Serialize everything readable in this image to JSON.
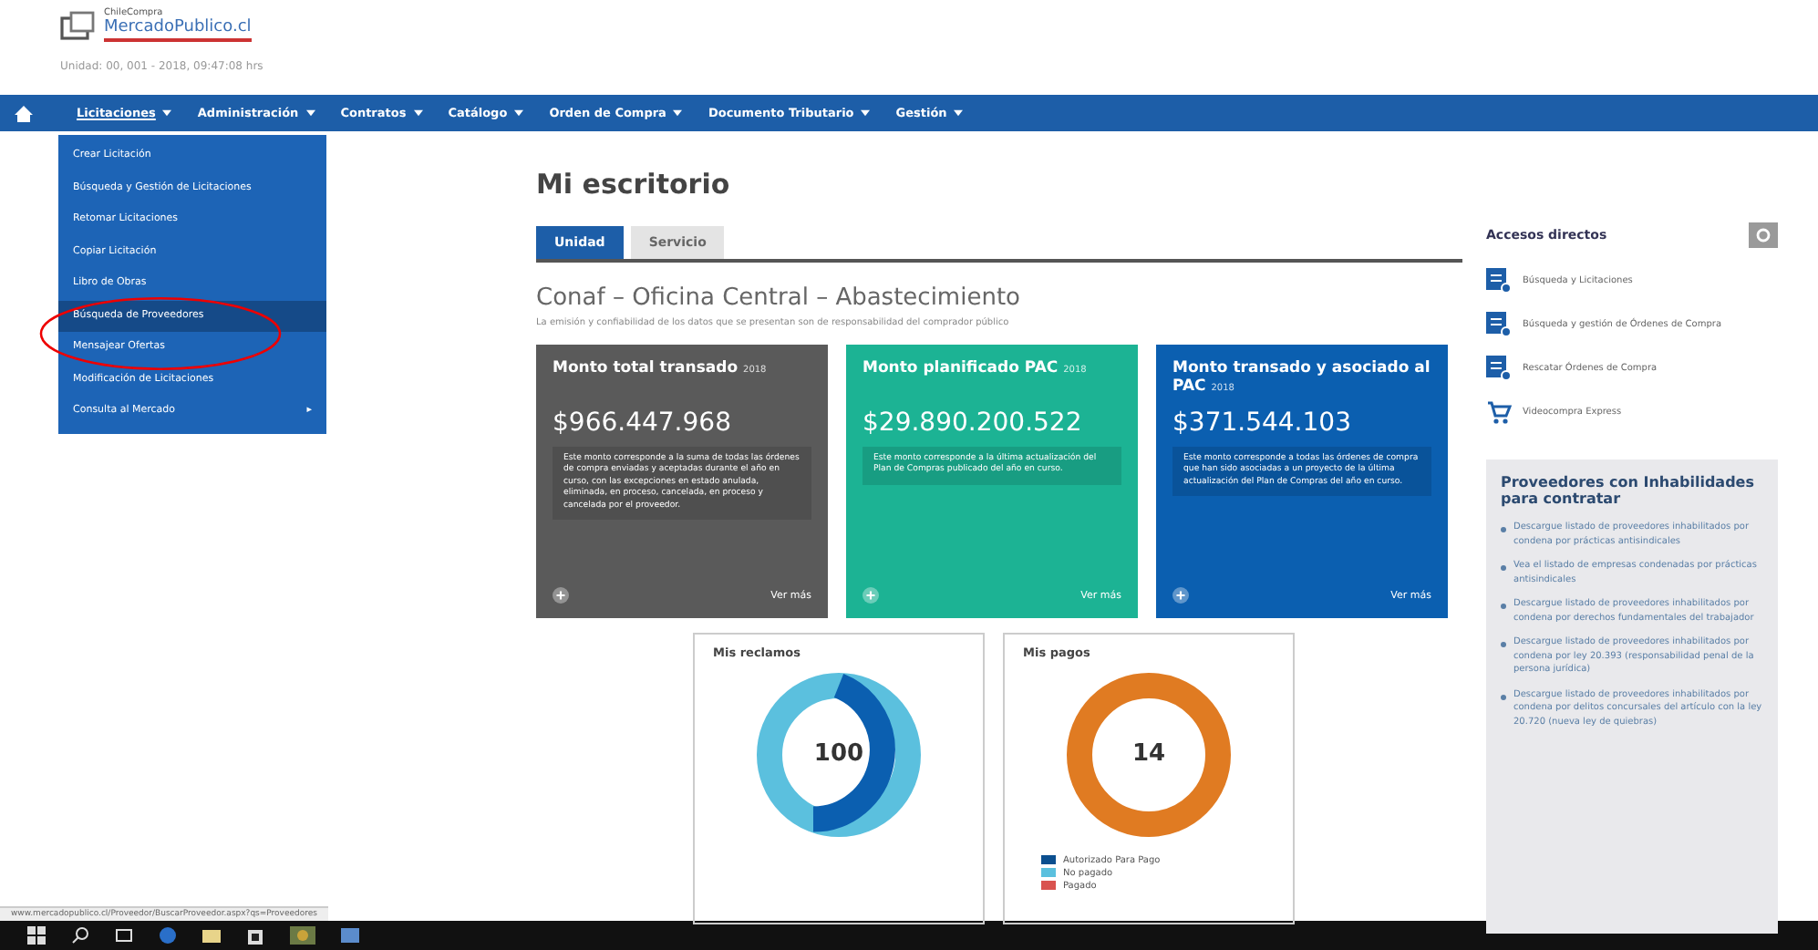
{
  "header": {
    "logo_caption": "ChileCompra",
    "logo_text": "MercadoPublico.cl",
    "tagline": "Unidad: 00, 001 - 2018, 09:47:08 hrs"
  },
  "nav": {
    "items": [
      {
        "label": "Licitaciones",
        "selected": true
      },
      {
        "label": "Administración",
        "selected": false
      },
      {
        "label": "Contratos",
        "selected": false
      },
      {
        "label": "Catálogo",
        "selected": false
      },
      {
        "label": "Orden de Compra",
        "selected": false
      },
      {
        "label": "Documento Tributario",
        "selected": false
      },
      {
        "label": "Gestión",
        "selected": false
      }
    ]
  },
  "dropdown": {
    "items": [
      {
        "label": "Crear Licitación",
        "selected": false
      },
      {
        "label": "Búsqueda y Gestión de Licitaciones",
        "selected": false
      },
      {
        "label": "Retomar Licitaciones",
        "selected": false
      },
      {
        "label": "Copiar Licitación",
        "selected": false
      },
      {
        "label": "Libro de Obras",
        "selected": false
      },
      {
        "label": "Búsqueda de Proveedores",
        "selected": true
      },
      {
        "label": "Mensajear Ofertas",
        "selected": false
      },
      {
        "label": "Modificación de Licitaciones",
        "selected": false
      },
      {
        "label": "Consulta al Mercado",
        "selected": false
      }
    ],
    "submenu_arrow": "▸"
  },
  "page_title": "Mi escritorio",
  "tabs": [
    {
      "label": "Unidad",
      "selected": true
    },
    {
      "label": "Servicio",
      "selected": false
    }
  ],
  "unit_title": "Conaf – Oficina Central – Abastecimiento",
  "unit_subtitle": "La emisión y confiabilidad de los datos que se presentan son de responsabilidad del comprador público",
  "cards": [
    {
      "title": "Monto total transado",
      "year": "2018",
      "amount": "$966.447.968",
      "description": "Este monto corresponde a la suma de todas las órdenes de compra enviadas y aceptadas durante el año en curso, con las excepciones en estado anulada, eliminada, en proceso, cancelada, en proceso y cancelada por el proveedor.",
      "link": "Ver más",
      "color": "#5a5a5a"
    },
    {
      "title": "Monto planificado PAC",
      "year": "2018",
      "amount": "$29.890.200.522",
      "description": "Este monto corresponde a la última actualización del Plan de Compras publicado del año en curso.",
      "link": "Ver más",
      "color": "#1cb394"
    },
    {
      "title": "Monto transado y asociado al PAC",
      "year": "2018",
      "amount": "$371.544.103",
      "description": "Este monto corresponde a todas las órdenes de compra que han sido asociadas a un proyecto de la última actualización del Plan de Compras del año en curso.",
      "link": "Ver más",
      "color": "#0b5fb0"
    }
  ],
  "claims": {
    "title": "Mis reclamos",
    "total": "100"
  },
  "payments": {
    "title": "Mis pagos",
    "total": "14",
    "legend": [
      {
        "label": "Autorizado Para Pago",
        "color": "#0b4f8f"
      },
      {
        "label": "No pagado",
        "color": "#5bc0de"
      },
      {
        "label": "Pagado",
        "color": "#d9534f"
      }
    ]
  },
  "shortcuts": {
    "title": "Accesos directos",
    "items": [
      {
        "label": "Búsqueda y Licitaciones",
        "kind": "doc"
      },
      {
        "label": "Búsqueda y gestión de Órdenes de Compra",
        "kind": "doc"
      },
      {
        "label": "Rescatar Órdenes de Compra",
        "kind": "doc"
      },
      {
        "label": "Videocompra Express",
        "kind": "cart"
      }
    ]
  },
  "inhabilities": {
    "title": "Proveedores con Inhabilidades para contratar",
    "items": [
      "Descargue listado de proveedores inhabilitados por condena por prácticas antisindicales",
      "Vea el listado de empresas condenadas por prácticas antisindicales",
      "Descargue listado de proveedores inhabilitados por condena por derechos fundamentales del trabajador",
      "Descargue listado de proveedores inhabilitados por condena por ley 20.393 (responsabilidad penal de la persona jurídica)",
      "Descargue listado de proveedores inhabilitados por condena por delitos concursales del artículo con la ley 20.720 (nueva ley de quiebras)"
    ]
  },
  "status_url": "www.mercadopublico.cl/Proveedor/BuscarProveedor.aspx?qs=Proveedores"
}
